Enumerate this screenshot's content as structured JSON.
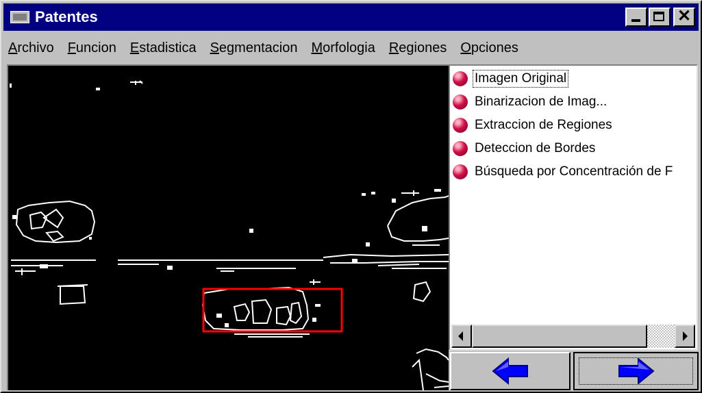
{
  "window": {
    "title": "Patentes",
    "icon": "app-window-icon",
    "controls": {
      "minimize": "minimize-icon",
      "maximize": "maximize-icon",
      "close": "close-icon"
    }
  },
  "menu": {
    "items": [
      {
        "accel": "A",
        "rest": "rchivo"
      },
      {
        "accel": "F",
        "rest": "uncion"
      },
      {
        "accel": "E",
        "rest": "stadistica"
      },
      {
        "accel": "S",
        "rest": "egmentacion"
      },
      {
        "accel": "M",
        "rest": "orfologia"
      },
      {
        "accel": "R",
        "rest": "egiones"
      },
      {
        "accel": "O",
        "rest": "pciones"
      }
    ]
  },
  "image_view": {
    "description_icon": "edge-detected-image",
    "highlight_color": "#ff0000"
  },
  "steps": {
    "items": [
      {
        "label": "Imagen Original",
        "icon": "sphere-icon",
        "selected": true
      },
      {
        "label": "Binarizacion de Imag...",
        "icon": "sphere-icon",
        "selected": false
      },
      {
        "label": "Extraccion de Regiones",
        "icon": "sphere-icon",
        "selected": false
      },
      {
        "label": "Deteccion de Bordes",
        "icon": "sphere-icon",
        "selected": false
      },
      {
        "label": "Búsqueda por Concentración de F",
        "icon": "sphere-icon",
        "selected": false
      }
    ]
  },
  "navigation": {
    "back_icon": "arrow-left-icon",
    "forward_icon": "arrow-right-icon",
    "arrow_color": "#0000ff"
  },
  "colors": {
    "titlebar": "#000080",
    "face": "#c0c0c0",
    "canvas": "#000000",
    "edges": "#ffffff"
  }
}
